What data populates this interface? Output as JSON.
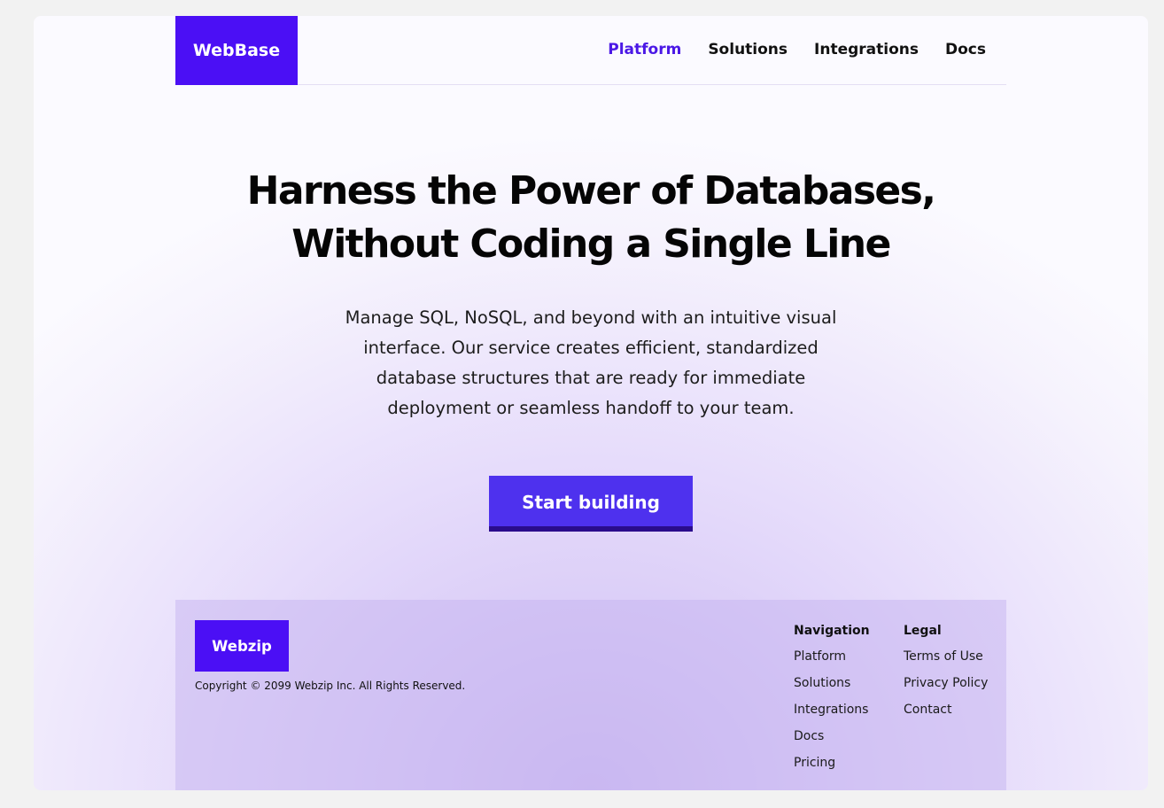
{
  "header": {
    "logo": "WebBase",
    "nav": [
      {
        "label": "Platform",
        "active": true
      },
      {
        "label": "Solutions",
        "active": false
      },
      {
        "label": "Integrations",
        "active": false
      },
      {
        "label": "Docs",
        "active": false
      }
    ]
  },
  "hero": {
    "headline_line1": "Harness the Power of Databases,",
    "headline_line2": "Without Coding a Single Line",
    "subtext": "Manage SQL, NoSQL, and beyond with an intuitive visual interface. Our service creates efficient, standardized database structures that are ready for immediate deployment or seamless handoff to your team.",
    "cta_label": "Start building"
  },
  "footer": {
    "logo": "Webzip",
    "copyright": "Copyright © 2099 Webzip Inc. All Rights Reserved.",
    "navigation": {
      "heading": "Navigation",
      "links": [
        "Platform",
        "Solutions",
        "Integrations",
        "Docs",
        "Pricing"
      ]
    },
    "legal": {
      "heading": "Legal",
      "links": [
        "Terms of Use",
        "Privacy Policy",
        "Contact"
      ]
    }
  },
  "colors": {
    "brand": "#4b0ff5",
    "accent_text": "#4b18e6",
    "button": "#4e31ee",
    "button_shadow": "#2a0c8c",
    "page_bg": "#f2f2f2"
  }
}
